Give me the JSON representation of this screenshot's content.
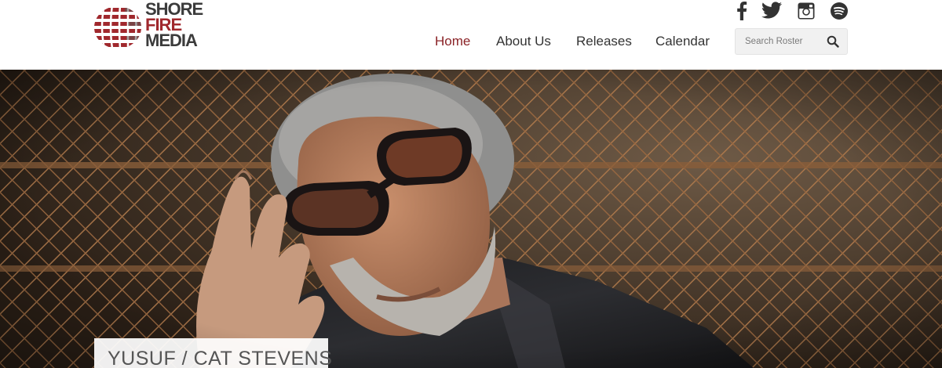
{
  "brand": {
    "logo_words": [
      "SHORE",
      "FIRE",
      "MEDIA"
    ],
    "colors": {
      "dark": "#3b3b3b",
      "red": "#a0282d",
      "nav_active": "#8a2226"
    }
  },
  "social": [
    {
      "name": "facebook-icon"
    },
    {
      "name": "twitter-icon"
    },
    {
      "name": "instagram-icon"
    },
    {
      "name": "spotify-icon"
    }
  ],
  "nav": {
    "items": [
      {
        "label": "Home",
        "active": true
      },
      {
        "label": "About Us",
        "active": false
      },
      {
        "label": "Releases",
        "active": false
      },
      {
        "label": "Calendar",
        "active": false
      }
    ]
  },
  "search": {
    "placeholder": "Search Roster",
    "value": "",
    "icon": "search-icon"
  },
  "hero": {
    "caption": "YUSUF / CAT STEVENS"
  }
}
